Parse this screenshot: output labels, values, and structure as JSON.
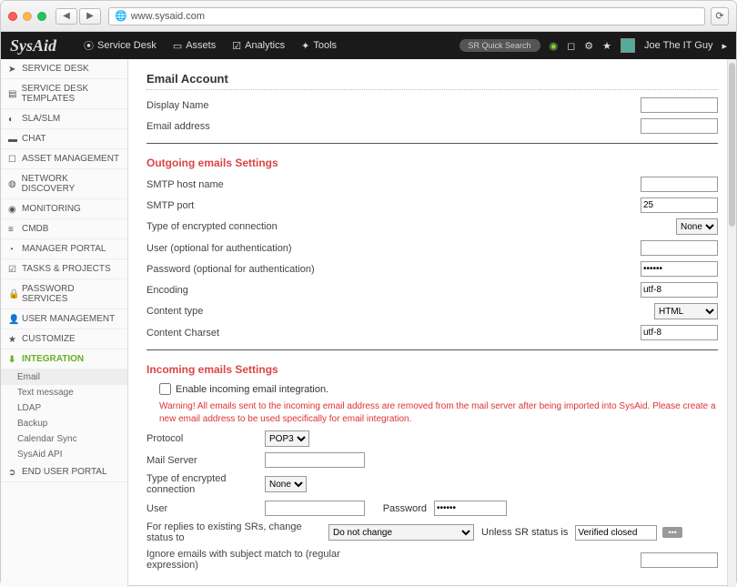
{
  "browser": {
    "url": "www.sysaid.com"
  },
  "header": {
    "logo": "SysAid",
    "nav": [
      "Service Desk",
      "Assets",
      "Analytics",
      "Tools"
    ],
    "search_placeholder": "SR Quick Search",
    "user": "Joe The IT Guy"
  },
  "sidebar": {
    "items": [
      "Service Desk",
      "Service Desk Templates",
      "SLA/SLM",
      "Chat",
      "Asset Management",
      "Network Discovery",
      "Monitoring",
      "CMDB",
      "Manager Portal",
      "Tasks & Projects",
      "Password Services",
      "User Management",
      "Customize",
      "Integration",
      "End User Portal"
    ],
    "active_index": 13,
    "sub_items": [
      "Email",
      "Text message",
      "LDAP",
      "Backup",
      "Calendar Sync",
      "SysAid API"
    ],
    "sub_selected_index": 0
  },
  "page": {
    "title": "Email Account",
    "account": {
      "display_name_label": "Display Name",
      "display_name": "",
      "email_label": "Email address",
      "email": ""
    },
    "outgoing": {
      "title": "Outgoing emails Settings",
      "smtp_host_label": "SMTP host name",
      "smtp_host": "",
      "smtp_port_label": "SMTP port",
      "smtp_port": "25",
      "enc_label": "Type of encrypted connection",
      "enc_value": "None",
      "user_label": "User (optional for authentication)",
      "user": "",
      "pass_label": "Password (optional for authentication)",
      "pass": "••••••",
      "encoding_label": "Encoding",
      "encoding": "utf-8",
      "ctype_label": "Content type",
      "ctype_value": "HTML",
      "charset_label": "Content Charset",
      "charset": "utf-8"
    },
    "incoming": {
      "title": "Incoming emails Settings",
      "enable_label": "Enable incoming email integration.",
      "warning": "Warning! All emails sent to the incoming email address are removed from the mail server after being imported into SysAid. Please create a new email address to be used specifically for email integration.",
      "protocol_label": "Protocol",
      "protocol_value": "POP3",
      "mail_server_label": "Mail Server",
      "mail_server": "",
      "enc_label": "Type of encrypted connection",
      "enc_value": "None",
      "user_label": "User",
      "user": "",
      "pass_label": "Password",
      "pass": "••••••",
      "replies_label": "For replies to existing SRs, change status to",
      "replies_value": "Do not change",
      "unless_label": "Unless SR status is",
      "unless_value": "Verified closed",
      "unless_btn": "•••",
      "ignore_label": "Ignore emails with subject match to (regular expression)",
      "ignore": ""
    }
  }
}
